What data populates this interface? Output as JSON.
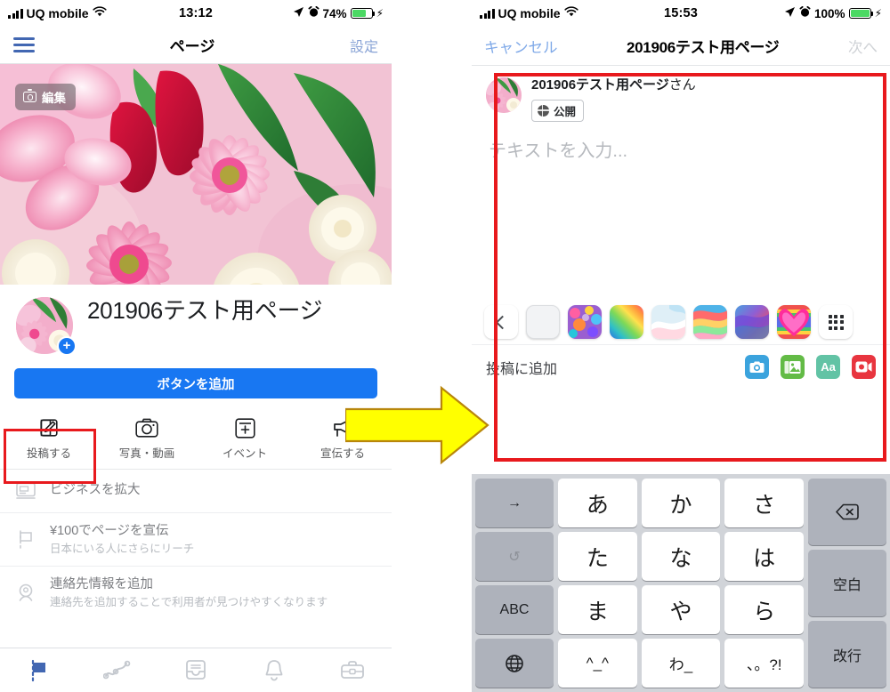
{
  "left_phone": {
    "status_bar": {
      "carrier": "UQ mobile",
      "time": "13:12",
      "battery_pct": "74%"
    },
    "nav": {
      "menu_icon": "hamburger-menu-icon",
      "title": "ページ",
      "action": "設定"
    },
    "cover": {
      "edit_label": "編集",
      "edit_icon": "camera-icon"
    },
    "profile": {
      "name": "201906テスト用ページ",
      "add_badge": "+"
    },
    "cta": {
      "label": "ボタンを追加"
    },
    "actions": [
      {
        "label": "投稿する",
        "icon": "compose-pencil-icon",
        "highlighted": true
      },
      {
        "label": "写真・動画",
        "icon": "camera-icon",
        "highlighted": false
      },
      {
        "label": "イベント",
        "icon": "event-plus-icon",
        "highlighted": false
      },
      {
        "label": "宣伝する",
        "icon": "megaphone-icon",
        "highlighted": false
      }
    ],
    "rows": [
      {
        "title": "ビジネスを拡大",
        "subtitle": "",
        "icon": "monitor-icon"
      },
      {
        "title": "¥100でページを宣伝",
        "subtitle": "日本にいる人にさらにリーチ",
        "icon": "flag-icon"
      },
      {
        "title": "連絡先情報を追加",
        "subtitle": "連絡先を追加することで利用者が見つけやすくなります",
        "icon": "location-pin-person-icon"
      }
    ],
    "tabbar": [
      {
        "icon": "flag-icon",
        "active": true
      },
      {
        "icon": "insights-chart-icon",
        "active": false
      },
      {
        "icon": "inbox-icon",
        "active": false
      },
      {
        "icon": "bell-notification-icon",
        "active": false
      },
      {
        "icon": "briefcase-icon",
        "active": false
      }
    ]
  },
  "right_phone": {
    "status_bar": {
      "carrier": "UQ mobile",
      "time": "15:53",
      "battery_pct": "100%"
    },
    "nav": {
      "cancel": "キャンセル",
      "title": "201906テスト用ページ",
      "next": "次へ"
    },
    "composer": {
      "author": "201906テスト用ページ",
      "author_suffix": "さん",
      "audience": "公開",
      "audience_icon": "globe-icon",
      "placeholder": "テキストを入力..."
    },
    "background_picker": {
      "back_icon": "chevron-left-icon",
      "grid_icon": "grid-more-icon",
      "thumbs": [
        {
          "name": "plain-white-background",
          "kind": "plain"
        },
        {
          "name": "confetti-background",
          "kind": "image"
        },
        {
          "name": "rainbow-diagonal-background",
          "kind": "image"
        },
        {
          "name": "pastel-wave-background",
          "kind": "image"
        },
        {
          "name": "rainbow-stripes-background",
          "kind": "image"
        },
        {
          "name": "purple-blue-gradient-background",
          "kind": "image"
        },
        {
          "name": "pink-heart-background",
          "kind": "image"
        }
      ]
    },
    "add_row": {
      "label": "投稿に追加",
      "icons": [
        {
          "name": "camera-icon",
          "color": "#3ba3dd"
        },
        {
          "name": "photo-library-icon",
          "color": "#63bb46"
        },
        {
          "name": "text-style-icon",
          "color": "#62c3a5",
          "glyph": "Aa"
        },
        {
          "name": "live-video-icon",
          "color": "#e8353f"
        }
      ]
    },
    "keyboard": {
      "keys": {
        "arrow_right": "→",
        "a": "あ",
        "ka": "か",
        "sa": "さ",
        "backspace": "⌫",
        "undo": "↺",
        "ta": "た",
        "na": "な",
        "ha": "は",
        "space": "空白",
        "abc": "ABC",
        "ma": "ま",
        "ya": "や",
        "ra": "ら",
        "globe": "⊕",
        "emoticon": "^_^",
        "wa": "わ_",
        "punct": "、。?!",
        "enter": "改行"
      }
    }
  },
  "annotations": {
    "arrow_color": "#ffff00",
    "arrow_outline": "#b8860b",
    "highlight_color": "#e8191d"
  }
}
